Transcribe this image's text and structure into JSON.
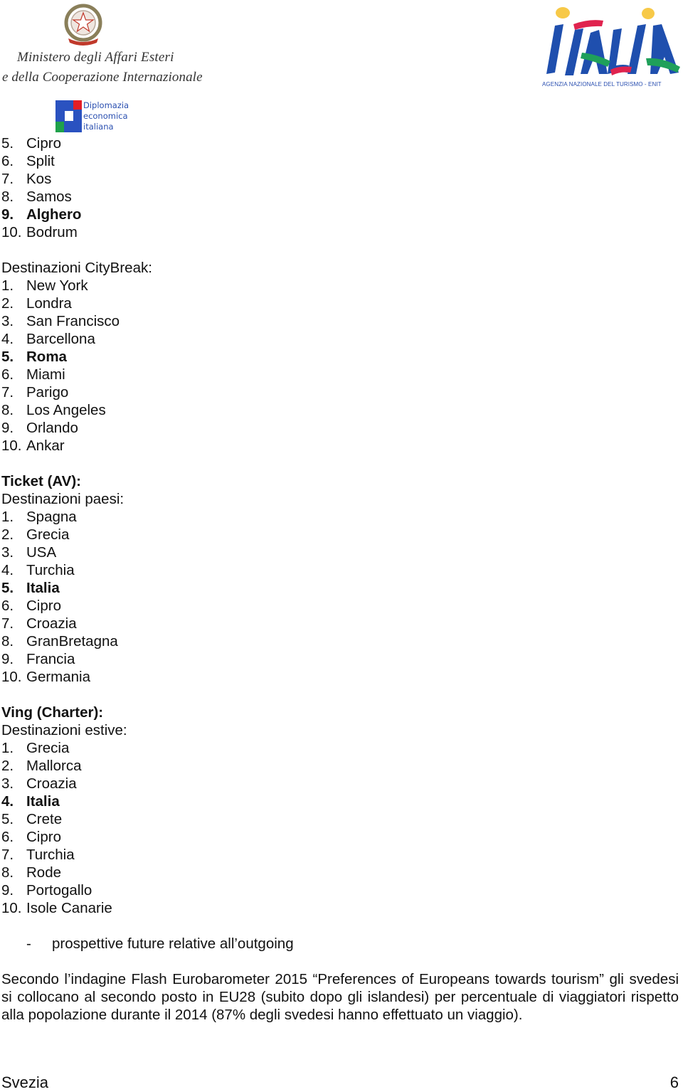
{
  "header": {
    "left_logo": {
      "emblem_icon": "italian-republic-emblem",
      "line1": "Ministero degli Affari Esteri",
      "line2": "e della Cooperazione Internazionale",
      "sub_logo": [
        "Diplomazia",
        "economica",
        "italiana"
      ]
    },
    "right_logo": {
      "wordmark": "ITALIA",
      "caption": "AGENZIA NAZIONALE DEL TURISMO - ENIT",
      "colors": {
        "blue": "#1f4fae",
        "red": "#e0234e",
        "green": "#1fa05a",
        "yellow": "#f7c948"
      }
    }
  },
  "list_continued": [
    {
      "num": "5.",
      "label": "Cipro",
      "bold": false
    },
    {
      "num": "6.",
      "label": "Split",
      "bold": false
    },
    {
      "num": "7.",
      "label": "Kos",
      "bold": false
    },
    {
      "num": "8.",
      "label": "Samos",
      "bold": false
    },
    {
      "num": "9.",
      "label": "Alghero",
      "bold": true
    },
    {
      "num": "10.",
      "label": "Bodrum",
      "bold": false
    }
  ],
  "citybreak": {
    "heading": "Destinazioni CityBreak:",
    "items": [
      {
        "num": "1.",
        "label": "New York",
        "bold": false
      },
      {
        "num": "2.",
        "label": "Londra",
        "bold": false
      },
      {
        "num": "3.",
        "label": "San Francisco",
        "bold": false
      },
      {
        "num": "4.",
        "label": "Barcellona",
        "bold": false
      },
      {
        "num": "5.",
        "label": "Roma",
        "bold": true
      },
      {
        "num": "6.",
        "label": "Miami",
        "bold": false
      },
      {
        "num": "7.",
        "label": "Parigo",
        "bold": false
      },
      {
        "num": "8.",
        "label": "Los Angeles",
        "bold": false
      },
      {
        "num": "9.",
        "label": "Orlando",
        "bold": false
      },
      {
        "num": "10.",
        "label": "Ankar",
        "bold": false
      }
    ]
  },
  "ticket": {
    "title": "Ticket (AV):",
    "heading": "Destinazioni paesi:",
    "items": [
      {
        "num": "1.",
        "label": "Spagna",
        "bold": false
      },
      {
        "num": "2.",
        "label": "Grecia",
        "bold": false
      },
      {
        "num": "3.",
        "label": "USA",
        "bold": false
      },
      {
        "num": "4.",
        "label": "Turchia",
        "bold": false
      },
      {
        "num": "5.",
        "label": "Italia",
        "bold": true
      },
      {
        "num": "6.",
        "label": "Cipro",
        "bold": false
      },
      {
        "num": "7.",
        "label": "Croazia",
        "bold": false
      },
      {
        "num": "8.",
        "label": "GranBretagna",
        "bold": false
      },
      {
        "num": "9.",
        "label": "Francia",
        "bold": false
      },
      {
        "num": "10.",
        "label": "Germania",
        "bold": false
      }
    ]
  },
  "ving": {
    "title": "Ving (Charter):",
    "heading": "Destinazioni estive:",
    "items": [
      {
        "num": "1.",
        "label": "Grecia",
        "bold": false
      },
      {
        "num": "2.",
        "label": "Mallorca",
        "bold": false
      },
      {
        "num": "3.",
        "label": "Croazia",
        "bold": false
      },
      {
        "num": "4.",
        "label": "Italia",
        "bold": true
      },
      {
        "num": "5.",
        "label": "Crete",
        "bold": false
      },
      {
        "num": "6.",
        "label": "Cipro",
        "bold": false
      },
      {
        "num": "7.",
        "label": "Turchia",
        "bold": false
      },
      {
        "num": "8.",
        "label": "Rode",
        "bold": false
      },
      {
        "num": "9.",
        "label": "Portogallo",
        "bold": false
      },
      {
        "num": "10.",
        "label": "Isole Canarie",
        "bold": false
      }
    ]
  },
  "section_bullet": {
    "dash": "-",
    "text": "prospettive future relative all’outgoing"
  },
  "paragraph": "Secondo l’indagine Flash Eurobarometer 2015 “Preferences of Europeans towards tourism” gli svedesi si collocano al secondo posto in EU28 (subito dopo gli islandesi) per percentuale di viaggiatori rispetto alla popolazione durante il 2014 (87% degli svedesi hanno effettuato un viaggio).",
  "footer": {
    "left": "Svezia",
    "page_number": "6"
  }
}
